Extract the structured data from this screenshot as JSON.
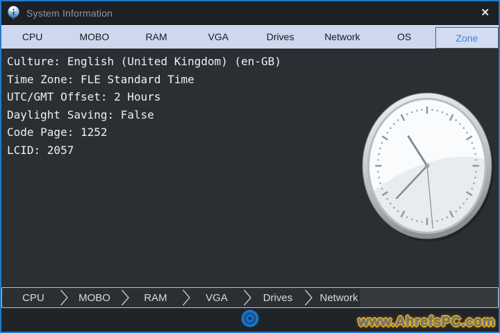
{
  "titlebar": {
    "title": "System Information",
    "close_label": "✕"
  },
  "tabs": [
    {
      "label": "CPU",
      "selected": false
    },
    {
      "label": "MOBO",
      "selected": false
    },
    {
      "label": "RAM",
      "selected": false
    },
    {
      "label": "VGA",
      "selected": false
    },
    {
      "label": "Drives",
      "selected": false
    },
    {
      "label": "Network",
      "selected": false
    },
    {
      "label": "OS",
      "selected": false
    },
    {
      "label": "Zone",
      "selected": true
    }
  ],
  "zone_info": [
    {
      "label": "Culture",
      "value": "English (United Kingdom) (en-GB)"
    },
    {
      "label": "Time Zone",
      "value": "FLE Standard Time"
    },
    {
      "label": "UTC/GMT Offset",
      "value": "2 Hours"
    },
    {
      "label": "Daylight Saving",
      "value": "False"
    },
    {
      "label": "Code Page",
      "value": "1252"
    },
    {
      "label": "LCID",
      "value": "2057"
    }
  ],
  "clock": {
    "hour_angle_deg": 324,
    "minute_angle_deg": 227,
    "second_angle_deg": 174
  },
  "breadcrumb": [
    "CPU",
    "MOBO",
    "RAM",
    "VGA",
    "Drives",
    "Network"
  ],
  "watermark": "www.AhrefsPC.com",
  "colors": {
    "window_border": "#2579cb",
    "titlebar_bg": "#1d2025",
    "tabbar_bg": "#cdd8ee",
    "selected_tab_text": "#3d82dd",
    "content_bg": "#2b2e33",
    "content_text": "#eef0f2",
    "hub_icon_blue": "#1b74c4"
  }
}
